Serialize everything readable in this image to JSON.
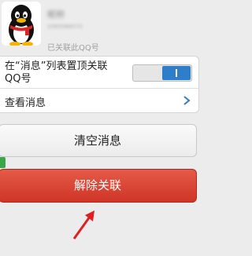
{
  "header": {
    "name": "昵称",
    "qq_number": "2065066070",
    "linked_text": "已关联此QQ号"
  },
  "settings": {
    "pin_label": "在“消息”列表置顶关联QQ号",
    "pin_toggle": "on",
    "view_messages_label": "查看消息"
  },
  "buttons": {
    "clear_label": "清空消息",
    "unlink_label": "解除关联"
  },
  "colors": {
    "accent": "#2e7ec9",
    "danger": "#d9402f",
    "annotation_arrow": "#e02020"
  }
}
